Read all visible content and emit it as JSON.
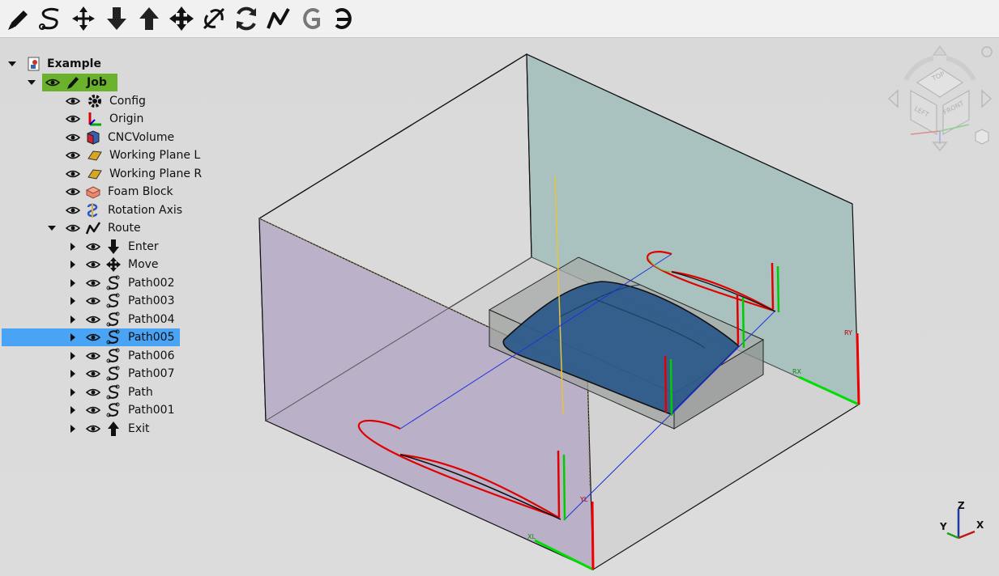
{
  "toolbar": {
    "buttons": [
      {
        "icon": "pencil-icon",
        "name": "toolbar-pencil-button"
      },
      {
        "icon": "path-s-icon",
        "name": "toolbar-path-button"
      },
      {
        "icon": "move-vertical-icon",
        "name": "toolbar-move-vertical-button"
      },
      {
        "icon": "arrow-down-icon",
        "name": "toolbar-enter-button"
      },
      {
        "icon": "arrow-up-icon",
        "name": "toolbar-exit-button"
      },
      {
        "icon": "move-icon",
        "name": "toolbar-move-button"
      },
      {
        "icon": "join-icon",
        "name": "toolbar-join-button"
      },
      {
        "icon": "refresh-icon",
        "name": "toolbar-refresh-button"
      },
      {
        "icon": "route-icon",
        "name": "toolbar-route-button"
      },
      {
        "icon": "gcode-icon",
        "name": "toolbar-gcode-button",
        "text": "G"
      },
      {
        "icon": "gcode-reverse-icon",
        "name": "toolbar-gcode-alt-button",
        "text": "G"
      }
    ]
  },
  "tree": {
    "root": {
      "label": "Example"
    },
    "items": [
      {
        "label": "Job"
      },
      {
        "label": "Config"
      },
      {
        "label": "Origin"
      },
      {
        "label": "CNCVolume"
      },
      {
        "label": "Working Plane L"
      },
      {
        "label": "Working Plane R"
      },
      {
        "label": "Foam Block"
      },
      {
        "label": "Rotation Axis"
      },
      {
        "label": "Route"
      },
      {
        "label": "Enter"
      },
      {
        "label": "Move"
      },
      {
        "label": "Path002"
      },
      {
        "label": "Path003"
      },
      {
        "label": "Path004"
      },
      {
        "label": "Path005"
      },
      {
        "label": "Path006"
      },
      {
        "label": "Path007"
      },
      {
        "label": "Path"
      },
      {
        "label": "Path001"
      },
      {
        "label": "Exit"
      }
    ]
  },
  "scene": {
    "axis_labels": {
      "xl": "XL",
      "yl": "YL",
      "rx": "RX",
      "ry": "RY"
    }
  },
  "navcube": {
    "top": "TOP",
    "left": "LEFT",
    "front": "FRONT"
  },
  "axes_indicator": {
    "x": "X",
    "y": "Y",
    "z": "Z"
  },
  "colors": {
    "job_highlight": "#6bb22c",
    "selection": "#4aa4f5",
    "wing": "#2d5b8a",
    "profile": "#e00000",
    "axis_x": "#00dd00",
    "axis_z": "#ee0000"
  }
}
